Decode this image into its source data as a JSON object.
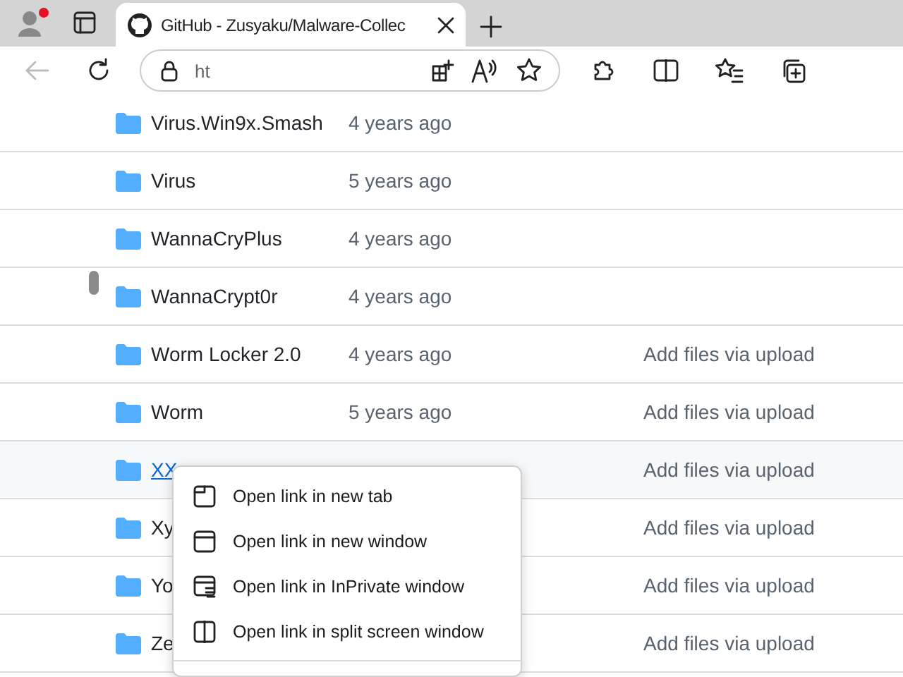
{
  "browser": {
    "tab": {
      "title": "GitHub - Zusyaku/Malware-Collec",
      "selected": true
    },
    "address": {
      "value": "ht"
    },
    "back": {
      "disabled": true
    }
  },
  "files": [
    {
      "name": "Virus.Win9x.Smash",
      "time": "4 years ago",
      "hovered": false
    },
    {
      "name": "Virus",
      "time": "5 years ago",
      "hovered": false
    },
    {
      "name": "WannaCryPlus",
      "time": "4 years ago",
      "hovered": false
    },
    {
      "name": "WannaCrypt0r",
      "time": "4 years ago",
      "hovered": false
    },
    {
      "name": "Worm Locker 2.0",
      "time": "4 years ago",
      "message": "Add files via upload",
      "hovered": false
    },
    {
      "name": "Worm",
      "time": "5 years ago",
      "message": "Add files via upload",
      "hovered": false
    },
    {
      "name": "XX",
      "message": "Add files via upload",
      "hovered": true
    },
    {
      "name": "Xy",
      "message": "Add files via upload",
      "hovered": false
    },
    {
      "name": "Yo",
      "message": "Add files via upload",
      "hovered": false
    },
    {
      "name": "Ze",
      "message": "Add files via upload",
      "hovered": false
    }
  ],
  "context_menu": {
    "items": [
      {
        "label": "Open link in new tab",
        "kind": "tab"
      },
      {
        "label": "Open link in new window",
        "kind": "window"
      },
      {
        "label": "Open link in InPrivate window",
        "kind": "inprivate"
      },
      {
        "label": "Open link in split screen window",
        "kind": "split"
      }
    ]
  }
}
